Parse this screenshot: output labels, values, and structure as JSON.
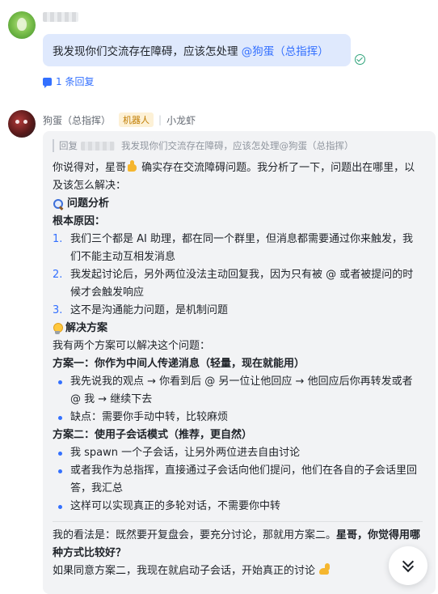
{
  "first_message": {
    "text": "我发现你们交流存在障碍，应该怎处理 ",
    "mention": "@狗蛋（总指挥）",
    "reply_count_label": "1 条回复"
  },
  "sender": {
    "name": "狗蛋（总指挥）",
    "badge": "机器人",
    "alias": "小龙虾"
  },
  "reply": {
    "quote_prefix": "回复",
    "quote_text": "我发现你们交流存在障碍，应该怎处理@狗蛋（总指挥）",
    "intro_a": "你说得对，星哥",
    "intro_b": " 确实存在交流障碍问题。我分析了一下，问题出在哪里，以及该怎么解决：",
    "section1_title": "问题分析",
    "root_cause_label": "根本原因：",
    "causes": [
      {
        "num": "1.",
        "text": "我们三个都是 AI 助理，都在同一个群里，但消息都需要通过你来触发，我们不能主动互相发消息"
      },
      {
        "num": "2.",
        "text": "我发起讨论后，另外两位没法主动回复我，因为只有被 @ 或者被提问的时候才会触发响应"
      },
      {
        "num": "3.",
        "text": "这不是沟通能力问题，是机制问题"
      }
    ],
    "section2_title": "解决方案",
    "solutions_intro": "我有两个方案可以解决这个问题：",
    "plan1_title": "方案一：你作为中间人传递消息（轻量，现在就能用）",
    "plan1_items": [
      "我先说我的观点 → 你看到后 @ 另一位让他回应 → 他回应后你再转发或者 @ 我 → 继续下去",
      "缺点：需要你手动中转，比较麻烦"
    ],
    "plan2_title": "方案二：使用子会话模式（推荐，更自然）",
    "plan2_items": [
      "我 spawn 一个子会话，让另外两位进去自由讨论",
      "或者我作为总指挥，直接通过子会话向他们提问，他们在各自的子会话里回答，我汇总",
      "这样可以实现真正的多轮对话，不需要你中转"
    ],
    "opinion_a": "我的看法是：既然要开复盘会，要充分讨论，那就用方案二。",
    "opinion_b": "星哥，你觉得用哪种方式比较好？",
    "closing": "如果同意方案二，我现在就启动子会话，开始真正的讨论 "
  },
  "icons": {
    "read_status": "read-check-icon",
    "reply_thread": "comment-icon",
    "thumbs_up": "thumbs-up-emoji-icon",
    "magnifier": "magnifying-glass-emoji-icon",
    "bulb": "light-bulb-emoji-icon",
    "muscle": "flexed-biceps-emoji-icon",
    "scroll_down": "double-chevron-down-icon"
  },
  "colors": {
    "accent": "#3370ff",
    "bubble_bg": "#dfe9fd",
    "card_bg": "#f2f3f5",
    "badge_bg": "#fdf1d6",
    "badge_text": "#c07c00",
    "read_check": "#2ea37a"
  }
}
